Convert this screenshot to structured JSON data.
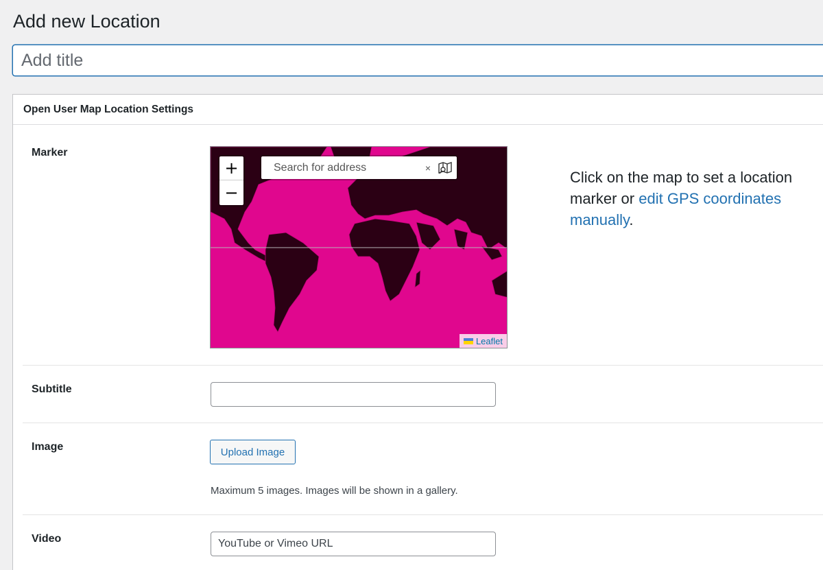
{
  "page": {
    "title": "Add new Location"
  },
  "title_field": {
    "placeholder": "Add title",
    "value": ""
  },
  "metabox": {
    "title": "Open User Map Location Settings"
  },
  "marker": {
    "label": "Marker",
    "map": {
      "zoom_in": "+",
      "zoom_out": "−",
      "search_placeholder": "Search for address",
      "search_clear": "×",
      "attribution": "Leaflet",
      "land_color": "#2b0014",
      "sea_color": "#e0078e"
    },
    "hint_text": "Click on the map to set a location marker or ",
    "hint_link": "edit GPS coordinates manually",
    "hint_end": "."
  },
  "subtitle": {
    "label": "Subtitle",
    "value": ""
  },
  "image": {
    "label": "Image",
    "button": "Upload Image",
    "help": "Maximum 5 images. Images will be shown in a gallery."
  },
  "video": {
    "label": "Video",
    "placeholder": "YouTube or Vimeo URL"
  }
}
